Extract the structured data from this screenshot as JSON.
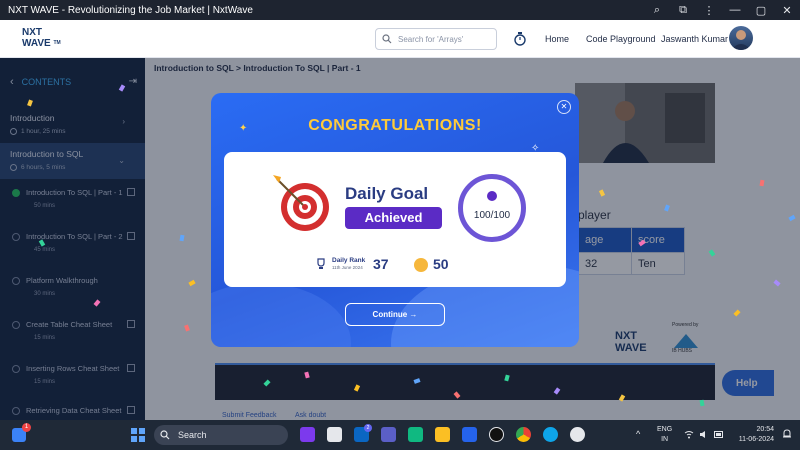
{
  "window": {
    "title": "NXT WAVE - Revolutionizing the Job Market | NxtWave",
    "ctrl_zoom": "⌕",
    "ctrl_share": "⧉",
    "ctrl_menu": "⋮",
    "ctrl_min": "—",
    "ctrl_max": "▢",
    "ctrl_close": "✕"
  },
  "header": {
    "logo_line1": "NXT",
    "logo_line2": "WAVE",
    "logo_tm": "TM",
    "search_placeholder": "Search for 'Arrays'",
    "nav_home": "Home",
    "nav_code": "Code Playground",
    "user_name": "Jaswanth Kumar"
  },
  "sidebar": {
    "heading": "CONTENTS",
    "back_icon": "‹",
    "collapse_icon": "⇥",
    "sections": [
      {
        "title": "Introduction",
        "duration": "1 hour, 25 mins"
      },
      {
        "title": "Introduction to SQL",
        "duration": "6 hours, 5 mins"
      }
    ],
    "items": [
      {
        "title": "Introduction To SQL | Part - 1",
        "duration": "50 mins"
      },
      {
        "title": "Introduction To SQL | Part - 2",
        "duration": "45 mins"
      },
      {
        "title": "Platform Walkthrough",
        "duration": "30 mins"
      },
      {
        "title": "Create Table Cheat Sheet",
        "duration": "15 mins"
      },
      {
        "title": "Inserting Rows Cheat Sheet",
        "duration": "15 mins"
      },
      {
        "title": "Retrieving Data Cheat Sheet",
        "duration": ""
      }
    ]
  },
  "main": {
    "breadcrumb": "Introduction to SQL > Introduction To SQL | Part - 1",
    "table_title": "player",
    "table_headers": [
      "age",
      "score"
    ],
    "table_row": [
      "32",
      "Ten"
    ],
    "logo_line1": "NXT",
    "logo_line2": "WAVE",
    "powered_by": "Powered by",
    "ibhubs": "IB HUBS",
    "help": "Help",
    "submit_feedback": "Submit Feedback",
    "ask_doubt": "Ask doubt"
  },
  "modal": {
    "title": "CONGRATULATIONS!",
    "close": "✕",
    "goal_title": "Daily Goal",
    "badge": "Achieved",
    "progress": "100/100",
    "rank_label": "Daily Rank",
    "rank_date": "11th June 2024",
    "rank_value": "37",
    "coins_value": "50",
    "continue_label": "Continue  →"
  },
  "taskbar": {
    "search": "Search",
    "notif_count": "1",
    "teams_count": "2",
    "lang1": "ENG",
    "lang2": "IN",
    "time": "20:54",
    "date": "11-06-2024",
    "chevron": "^"
  },
  "colors": {
    "primary": "#2a6cf4",
    "sidebar": "#12233f",
    "accent_gold": "#ffcb3a",
    "badge_purple": "#5b2bc5"
  }
}
